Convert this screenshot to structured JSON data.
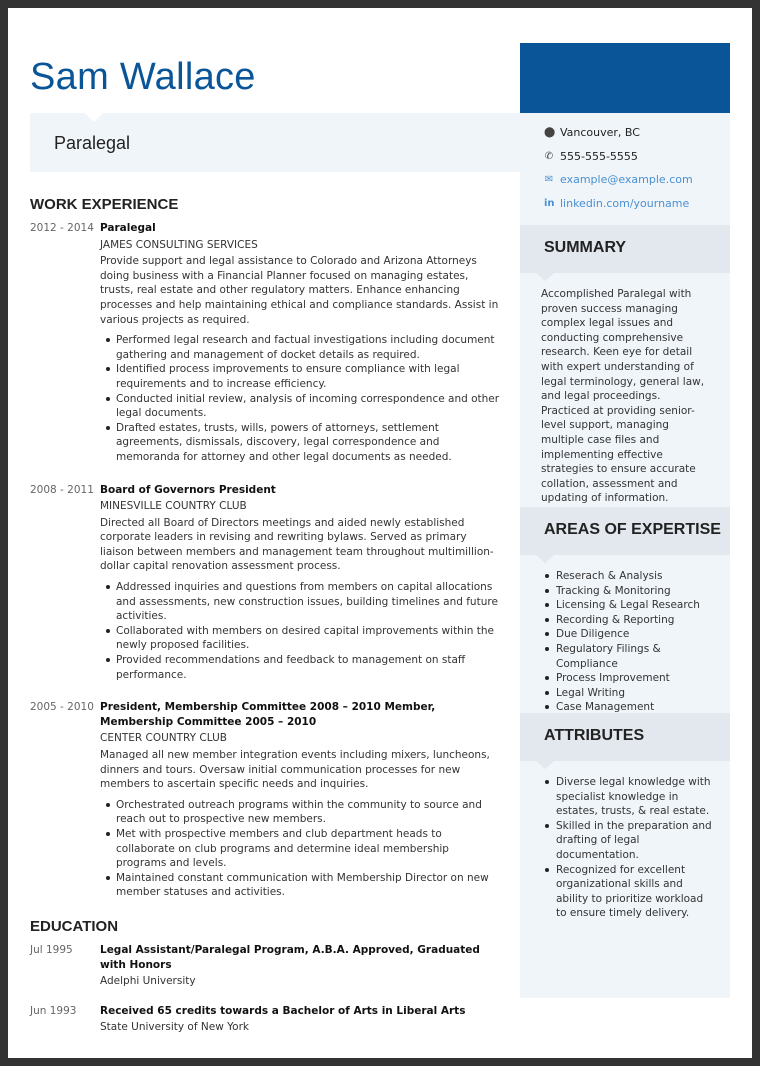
{
  "header": {
    "name": "Sam Wallace",
    "title": "Paralegal"
  },
  "contact": {
    "location": "Vancouver, BC",
    "phone": "555-555-5555",
    "email": "example@example.com",
    "linkedin": "linkedin.com/yourname"
  },
  "colors": {
    "accent": "#0a5598",
    "sidebar_bg": "#f0f5fa",
    "section_header_bg": "#e2e8ee"
  },
  "summary": {
    "heading": "SUMMARY",
    "text": "Accomplished Paralegal with proven success managing complex legal issues and conducting comprehensive research. Keen eye for detail with expert understanding of legal terminology, general law, and legal proceedings. Practiced at providing senior-level support, managing multiple case files and implementing effective strategies to ensure accurate collation, assessment and updating of information."
  },
  "expertise": {
    "heading": "AREAS OF EXPERTISE",
    "items": [
      "Reserach & Analysis",
      "Tracking & Monitoring",
      "Licensing & Legal Research",
      "Recording & Reporting",
      "Due Diligence",
      "Regulatory Filings & Compliance",
      "Process Improvement",
      "Legal Writing",
      "Case Management"
    ]
  },
  "attributes": {
    "heading": "ATTRIBUTES",
    "items": [
      "Diverse legal knowledge with specialist knowledge in estates, trusts, & real estate.",
      "Skilled in the preparation and drafting of legal documentation.",
      "Recognized for excellent organizational skills and ability to prioritize workload to ensure timely delivery."
    ]
  },
  "work": {
    "heading": "WORK EXPERIENCE",
    "jobs": [
      {
        "dates": "2012 - 2014",
        "title": "Paralegal",
        "company": "JAMES CONSULTING SERVICES",
        "description": "Provide support and legal assistance to Colorado and Arizona Attorneys doing business with a Financial Planner focused on managing estates, trusts, real estate and other regulatory matters. Enhance enhancing processes and help maintaining ethical and compliance standards. Assist in various projects as required.",
        "bullets": [
          "Performed legal research and factual investigations including document gathering and management of docket details as required.",
          "Identified process improvements to ensure compliance with legal requirements and to increase efficiency.",
          "Conducted initial review, analysis of incoming correspondence and other legal documents.",
          "Drafted estates, trusts, wills, powers of attorneys, settlement agreements, dismissals, discovery, legal correspondence and memoranda for attorney and other legal documents as needed."
        ]
      },
      {
        "dates": "2008 - 2011",
        "title": "Board of Governors President",
        "company": "MINESVILLE COUNTRY CLUB",
        "description": "Directed all Board of Directors meetings and aided newly established corporate leaders in revising and rewriting bylaws. Served as primary liaison between members and management team throughout multimillion-dollar capital renovation assessment process.",
        "bullets": [
          "Addressed inquiries and questions from members on capital allocations and assessments, new construction issues, building timelines and future activities.",
          "Collaborated with members on desired capital improvements within the newly proposed facilities.",
          "Provided recommendations and feedback to management on staff performance."
        ]
      },
      {
        "dates": "2005 - 2010",
        "title": "President, Membership Committee 2008 – 2010 Member, Membership Committee 2005 – 2010",
        "company": "CENTER COUNTRY CLUB",
        "description": "Managed all new member integration events including mixers, luncheons, dinners and tours. Oversaw initial communication processes for new members to ascertain specific needs and inquiries.",
        "bullets": [
          "Orchestrated outreach programs within the community to source and reach out to prospective new members.",
          "Met with prospective members and club department heads to collaborate on club programs and determine ideal membership programs and levels.",
          "Maintained constant communication with Membership Director on new member statuses and activities."
        ]
      }
    ]
  },
  "education": {
    "heading": "EDUCATION",
    "items": [
      {
        "date": "Jul 1995",
        "degree": "Legal Assistant/Paralegal Program, A.B.A. Approved, Graduated with Honors",
        "school": "Adelphi University"
      },
      {
        "date": "Jun 1993",
        "degree": "Received 65 credits towards a Bachelor of Arts in Liberal Arts",
        "school": "State University of New York"
      }
    ]
  }
}
